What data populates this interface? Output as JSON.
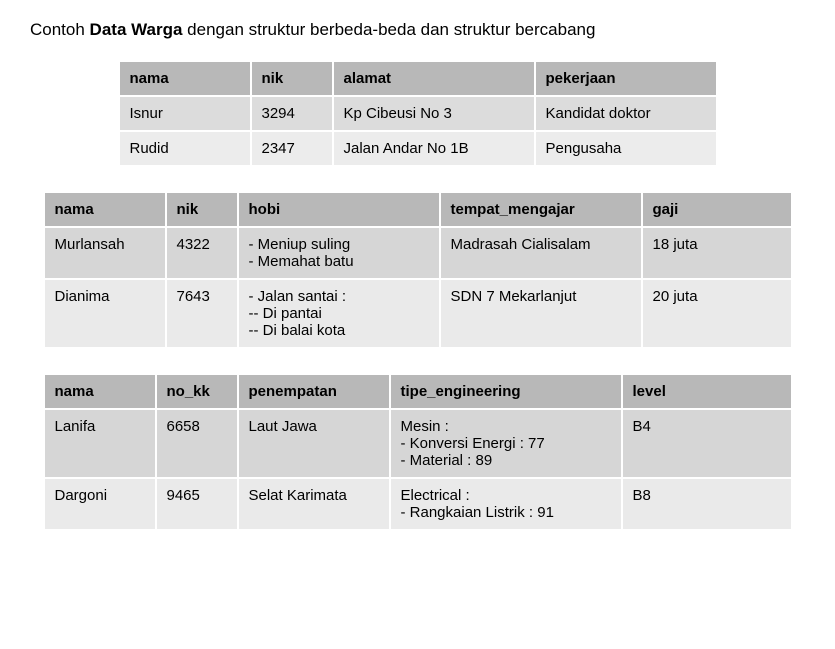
{
  "title": {
    "prefix": "Contoh ",
    "bold": "Data Warga",
    "suffix": " dengan struktur berbeda-beda dan struktur bercabang"
  },
  "table1": {
    "headers": [
      "nama",
      "nik",
      "alamat",
      "pekerjaan"
    ],
    "rows": [
      {
        "nama": "Isnur",
        "nik": "3294",
        "alamat": "Kp Cibeusi No 3",
        "pekerjaan": "Kandidat doktor"
      },
      {
        "nama": "Rudid",
        "nik": "2347",
        "alamat": "Jalan Andar No 1B",
        "pekerjaan": "Pengusaha"
      }
    ]
  },
  "table2": {
    "headers": [
      "nama",
      "nik",
      "hobi",
      "tempat_mengajar",
      "gaji"
    ],
    "rows": [
      {
        "nama": "Murlansah",
        "nik": "4322",
        "hobi": [
          "- Meniup suling",
          "- Memahat batu"
        ],
        "tempat_mengajar": "Madrasah Cialisalam",
        "gaji": "18 juta"
      },
      {
        "nama": "Dianima",
        "nik": "7643",
        "hobi": [
          "- Jalan santai :",
          "-- Di pantai",
          "-- Di balai kota"
        ],
        "tempat_mengajar": "SDN 7 Mekarlanjut",
        "gaji": "20 juta"
      }
    ]
  },
  "table3": {
    "headers": [
      "nama",
      "no_kk",
      "penempatan",
      "tipe_engineering",
      "level"
    ],
    "rows": [
      {
        "nama": "Lanifa",
        "no_kk": "6658",
        "penempatan": "Laut Jawa",
        "tipe_engineering": [
          "Mesin :",
          "- Konversi Energi : 77",
          "- Material : 89"
        ],
        "level": "B4"
      },
      {
        "nama": "Dargoni",
        "no_kk": "9465",
        "penempatan": "Selat Karimata",
        "tipe_engineering": [
          "Electrical :",
          "- Rangkaian Listrik : 91"
        ],
        "level": "B8"
      }
    ]
  }
}
